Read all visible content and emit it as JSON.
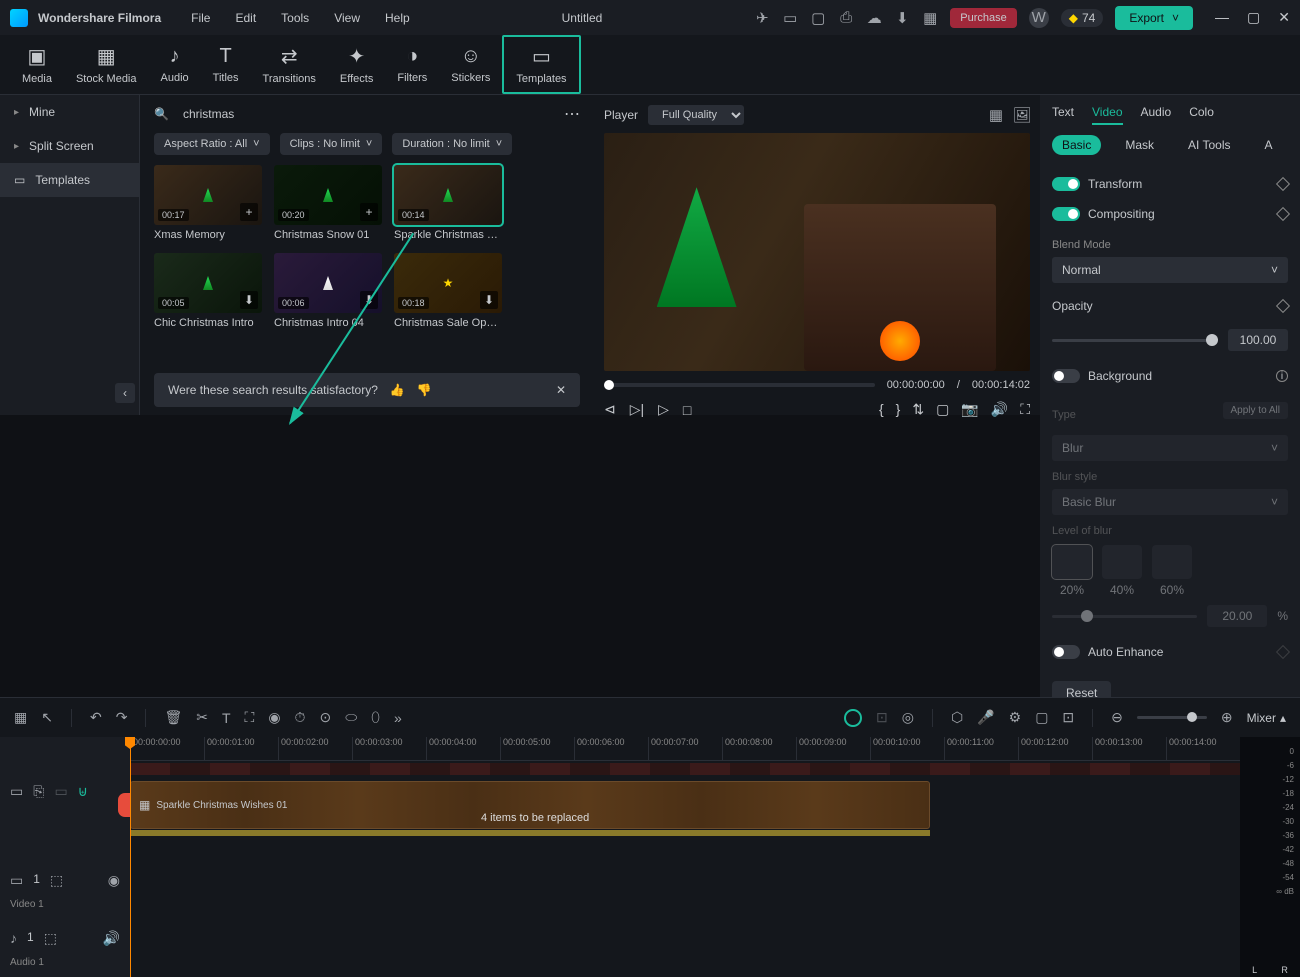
{
  "app_name": "Wondershare Filmora",
  "menu": [
    "File",
    "Edit",
    "Tools",
    "View",
    "Help"
  ],
  "doc_title": "Untitled",
  "purchase": "Purchase",
  "credits": "74",
  "export": "Export",
  "tools": [
    {
      "label": "Media"
    },
    {
      "label": "Stock Media"
    },
    {
      "label": "Audio"
    },
    {
      "label": "Titles"
    },
    {
      "label": "Transitions"
    },
    {
      "label": "Effects"
    },
    {
      "label": "Filters"
    },
    {
      "label": "Stickers"
    },
    {
      "label": "Templates"
    }
  ],
  "sidebar": [
    {
      "label": "Mine"
    },
    {
      "label": "Split Screen"
    },
    {
      "label": "Templates"
    }
  ],
  "search": {
    "value": "christmas"
  },
  "filters": {
    "aspect": "Aspect Ratio : All",
    "clips": "Clips : No limit",
    "duration": "Duration : No limit"
  },
  "cards": [
    {
      "name": "Xmas Memory",
      "dur": "00:17"
    },
    {
      "name": "Christmas Snow 01",
      "dur": "00:20"
    },
    {
      "name": "Sparkle Christmas Wis...",
      "dur": "00:14"
    },
    {
      "name": "Chic Christmas Intro",
      "dur": "00:05"
    },
    {
      "name": "Christmas Intro 04",
      "dur": "00:06"
    },
    {
      "name": "Christmas Sale Opener",
      "dur": "00:18"
    }
  ],
  "feedback": {
    "text": "Were these search results satisfactory?"
  },
  "player": {
    "label": "Player",
    "quality": "Full Quality",
    "current": "00:00:00:00",
    "total": "00:00:14:02"
  },
  "props": {
    "tabs": [
      "Text",
      "Video",
      "Audio",
      "Colo"
    ],
    "sub": [
      "Basic",
      "Mask",
      "AI Tools",
      "A"
    ],
    "transform": "Transform",
    "compositing": "Compositing",
    "blend_label": "Blend Mode",
    "blend": "Normal",
    "opacity_label": "Opacity",
    "opacity": "100.00",
    "background": "Background",
    "type_label": "Type",
    "type": "Blur",
    "apply_all": "Apply to All",
    "blurstyle_label": "Blur style",
    "blurstyle": "Basic Blur",
    "level_label": "Level of blur",
    "blur_percents": [
      "20%",
      "40%",
      "60%"
    ],
    "blur_value": "20.00",
    "blur_unit": "%",
    "auto_enhance": "Auto Enhance",
    "reset": "Reset"
  },
  "timeline": {
    "ticks": [
      "00:00:00:00",
      "00:00:01:00",
      "00:00:02:00",
      "00:00:03:00",
      "00:00:04:00",
      "00:00:05:00",
      "00:00:06:00",
      "00:00:07:00",
      "00:00:08:00",
      "00:00:09:00",
      "00:00:10:00",
      "00:00:11:00",
      "00:00:12:00",
      "00:00:13:00",
      "00:00:14:00"
    ],
    "clip_name": "Sparkle Christmas Wishes 01",
    "replace": "4 items to be replaced",
    "video_track": "Video 1",
    "audio_track": "Audio 1",
    "mixer": "Mixer",
    "meter": [
      "0",
      "-6",
      "-12",
      "-18",
      "-24",
      "-30",
      "-36",
      "-42",
      "-48",
      "-54",
      "∞ dB"
    ],
    "L": "L",
    "R": "R"
  }
}
